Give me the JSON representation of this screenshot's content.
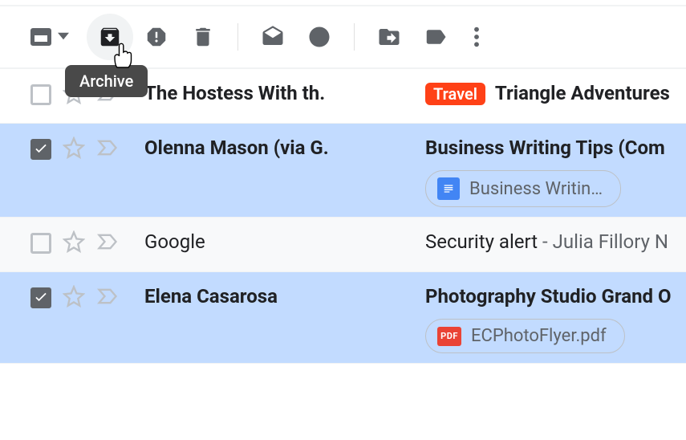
{
  "toolbar": {
    "tooltip_archive": "Archive"
  },
  "rows": [
    {
      "sender": "The Hostess With th.",
      "label": "Travel",
      "subject": "Triangle Adventures"
    },
    {
      "sender": "Olenna Mason (via G.",
      "subject": "Business Writing Tips (Com",
      "attachment": "Business Writin…"
    },
    {
      "sender": "Google",
      "subject": "Security alert",
      "trail": " - Julia Fillory N"
    },
    {
      "sender": "Elena Casarosa",
      "subject": "Photography Studio Grand O",
      "attachment": "ECPhotoFlyer.pdf",
      "attachment_badge": "PDF"
    }
  ]
}
